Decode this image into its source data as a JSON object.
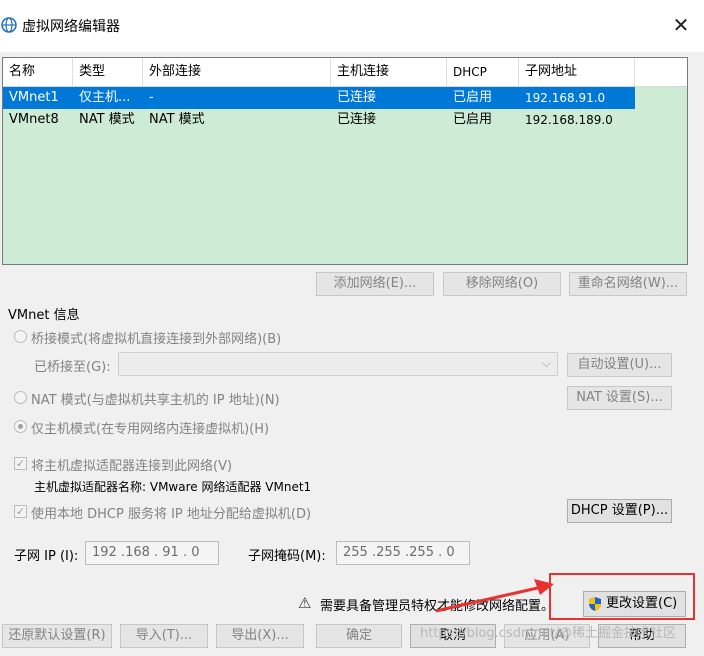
{
  "window": {
    "title": "虚拟网络编辑器",
    "close_label": "✕"
  },
  "table": {
    "columns": [
      "名称",
      "类型",
      "外部连接",
      "主机连接",
      "DHCP",
      "子网地址"
    ],
    "rows": [
      {
        "name": "VMnet1",
        "type": "仅主机...",
        "external": "-",
        "host": "已连接",
        "dhcp": "已启用",
        "subnet": "192.168.91.0",
        "selected": true
      },
      {
        "name": "VMnet8",
        "type": "NAT 模式",
        "external": "NAT 模式",
        "host": "已连接",
        "dhcp": "已启用",
        "subnet": "192.168.189.0",
        "selected": false
      }
    ]
  },
  "table_buttons": {
    "add": "添加网络(E)...",
    "remove": "移除网络(O)",
    "rename": "重命名网络(W)..."
  },
  "vmnet_info": {
    "group_label": "VMnet 信息",
    "bridged_label": "桥接模式(将虚拟机直接连接到外部网络)(B)",
    "bridged_to_label": "已桥接至(G):",
    "auto_settings": "自动设置(U)...",
    "nat_label": "NAT 模式(与虚拟机共享主机的 IP 地址)(N)",
    "nat_settings": "NAT 设置(S)...",
    "hostonly_label": "仅主机模式(在专用网络内连接虚拟机)(H)",
    "connect_adapter_label": "将主机虚拟适配器连接到此网络(V)",
    "adapter_name_label": "主机虚拟适配器名称: VMware 网络适配器 VMnet1",
    "dhcp_label": "使用本地 DHCP 服务将 IP 地址分配给虚拟机(D)",
    "dhcp_settings": "DHCP 设置(P)...",
    "subnet_ip_label": "子网 IP (I):",
    "subnet_ip_value": "192 .168 . 91 . 0",
    "subnet_mask_label": "子网掩码(M):",
    "subnet_mask_value": "255 .255 .255 . 0"
  },
  "admin": {
    "warning_text": "需要具备管理员特权才能修改网络配置。",
    "change_settings": "更改设置(C)"
  },
  "footer_buttons": {
    "restore": "还原默认设置(R)",
    "import": "导入(T)...",
    "export": "导出(X)...",
    "ok": "确定",
    "cancel": "取消",
    "apply": "应用(A)",
    "help": "帮助"
  },
  "watermark": "https://blog.csdn.net/@稀土掘金技术社区",
  "colors": {
    "selection": "#0078d7",
    "table_bg": "#cdebd5",
    "highlight": "#e8322f"
  }
}
